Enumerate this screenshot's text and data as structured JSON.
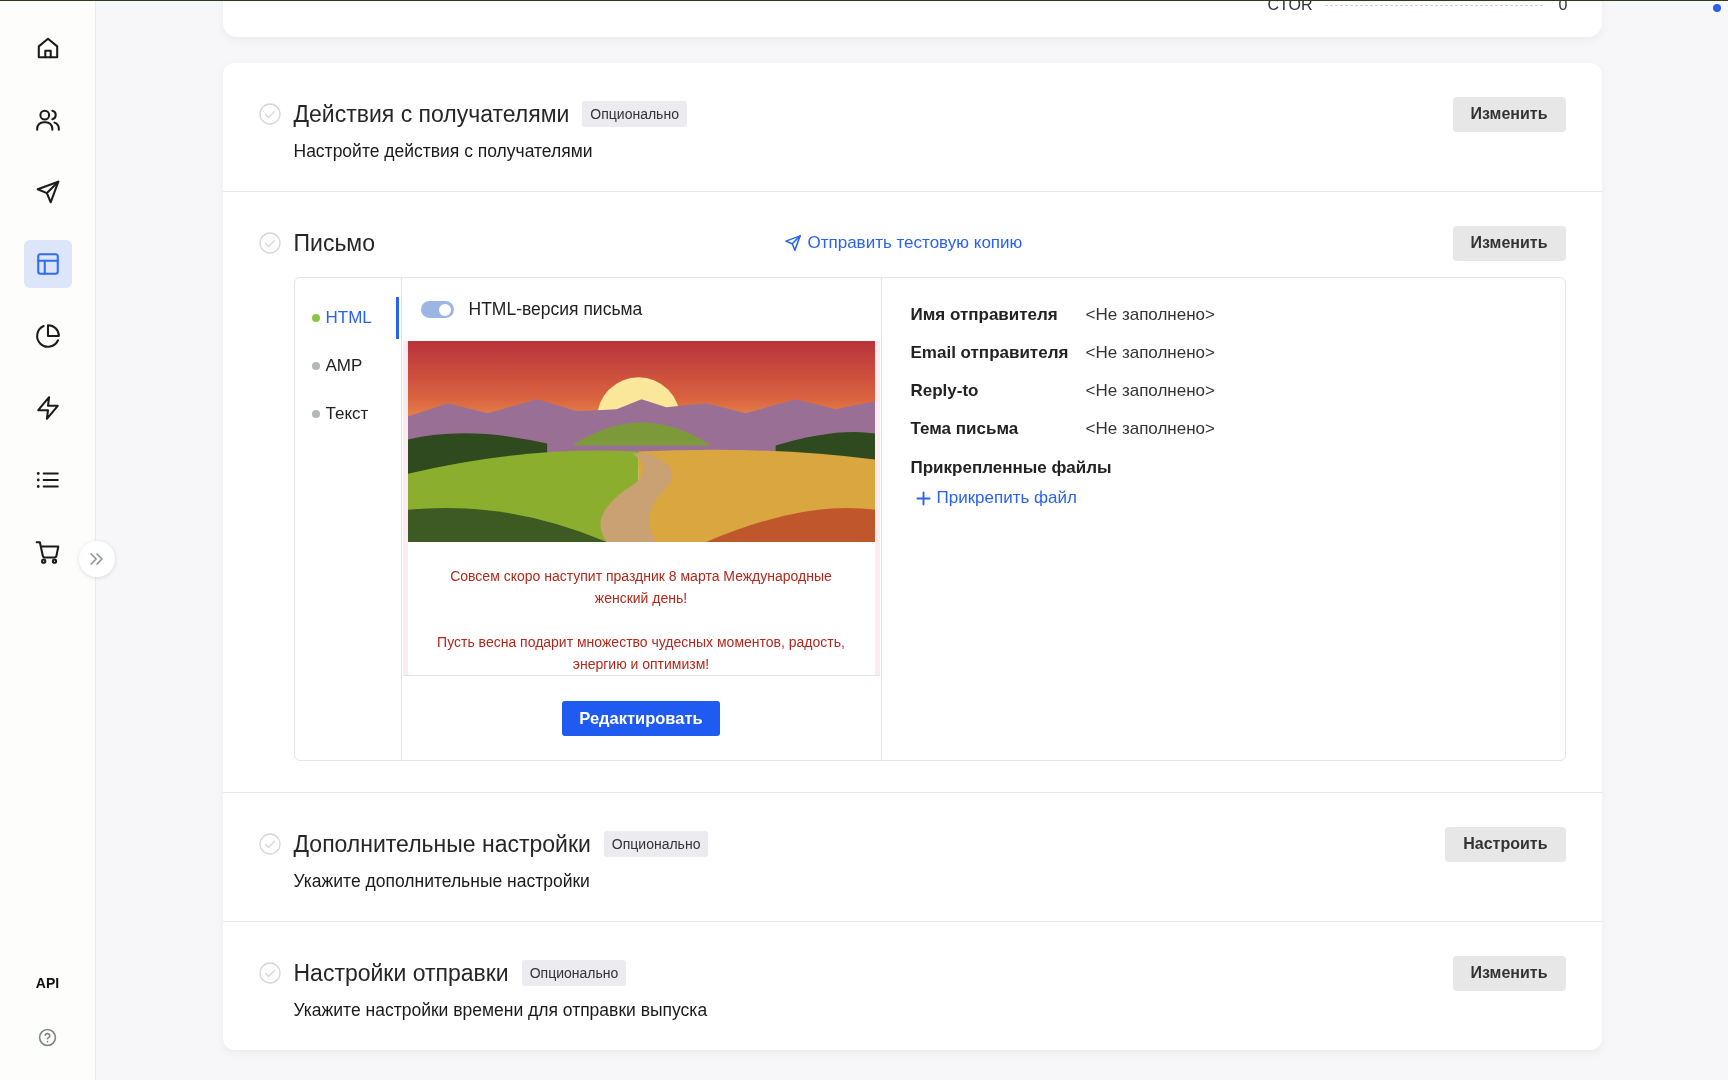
{
  "sidebar": {
    "items": [
      {
        "selected": false
      },
      {
        "selected": false
      },
      {
        "selected": false
      },
      {
        "selected": true
      },
      {
        "selected": false
      },
      {
        "selected": false
      },
      {
        "selected": false
      },
      {
        "selected": false
      }
    ],
    "footer_label": "API"
  },
  "top_card": {
    "metric_label": "CTOR",
    "metric_value": "0"
  },
  "sections": [
    {
      "kind": "summary",
      "completed": false,
      "title": "Действия с получателями",
      "badge": "Опционально",
      "description": "Настройте действия с получателями",
      "button": "Изменить"
    },
    {
      "kind": "letter",
      "completed": false,
      "title": "Письмо",
      "test_link": "Отправить тестовую копию",
      "button": "Изменить",
      "formats": [
        {
          "label": "HTML",
          "selected": true,
          "on": true
        },
        {
          "label": "AMP",
          "selected": false,
          "on": false
        },
        {
          "label": "Текст",
          "selected": false,
          "on": false
        }
      ],
      "toggle": {
        "label": "HTML-версия письма",
        "on": true
      },
      "preview": {
        "paragraphs": [
          "Совсем скоро наступит праздник 8 марта Международные женский день!",
          "Пусть весна подарит множество чудесных моментов, радость, энергию и оптимизм!"
        ]
      },
      "edit_button": "Редактировать",
      "details": [
        {
          "label": "Имя отправителя",
          "value": "<Не заполнено>"
        },
        {
          "label": "Email отправителя",
          "value": "<Не заполнено>"
        },
        {
          "label": "Reply-to",
          "value": "<Не заполнено>"
        },
        {
          "label": "Тема письма",
          "value": "<Не заполнено>"
        }
      ],
      "attachments": {
        "label": "Прикрепленные файлы",
        "link": "Прикрепить файл"
      }
    },
    {
      "kind": "summary",
      "completed": false,
      "title": "Дополнительные настройки",
      "badge": "Опционально",
      "description": "Укажите дополнительные настройки",
      "button": "Настроить"
    },
    {
      "kind": "summary",
      "completed": false,
      "title": "Настройки отправки",
      "badge": "Опционально",
      "description": "Укажите настройки времени для отправки выпуска",
      "button": "Изменить"
    }
  ]
}
